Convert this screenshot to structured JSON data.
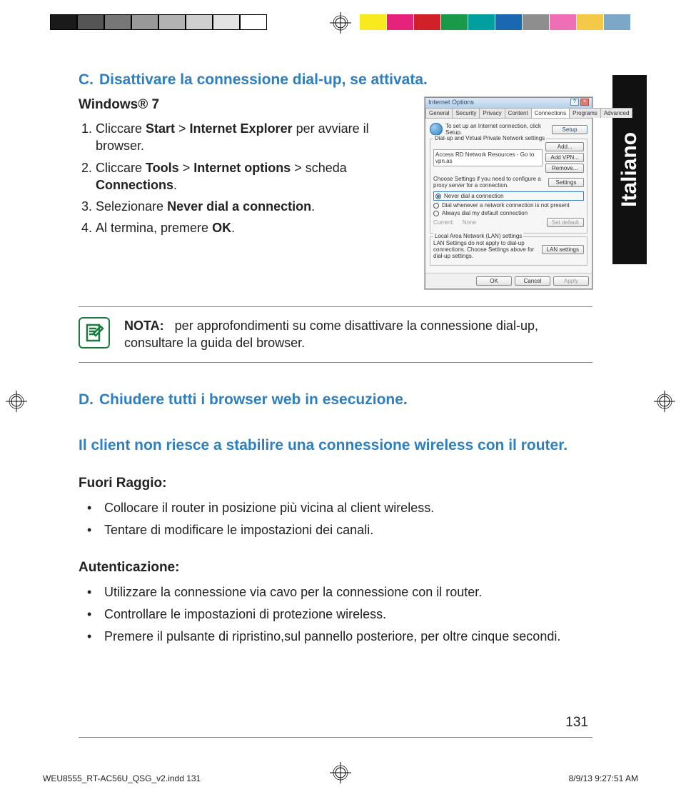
{
  "language_tab": "Italiano",
  "sectionC": {
    "letter": "C.",
    "title": "Disattivare la connessione dial-up, se attivata.",
    "os": "Windows® 7",
    "steps": [
      {
        "pre": "Cliccare ",
        "b1": "Start",
        "mid": " > ",
        "b2": "Internet Explorer",
        "post": " per avviare il browser."
      },
      {
        "pre": "Cliccare ",
        "b1": "Tools",
        "mid": " > ",
        "b2": "Internet options",
        "post2": " > scheda ",
        "b3": "Connections",
        "tail": "."
      },
      {
        "pre": "Selezionare ",
        "b1": "Never dial a connection",
        "tail": "."
      },
      {
        "pre": "Al termina, premere ",
        "b1": "OK",
        "tail": "."
      }
    ]
  },
  "screenshot": {
    "title": "Internet Options",
    "tabs": [
      "General",
      "Security",
      "Privacy",
      "Content",
      "Connections",
      "Programs",
      "Advanced"
    ],
    "active_tab": "Connections",
    "setup_text": "To set up an Internet connection, click Setup.",
    "setup_btn": "Setup",
    "dialup_legend": "Dial-up and Virtual Private Network settings",
    "list_item": "Access RD Network Resources - Go to vpn.as",
    "btns": {
      "add": "Add...",
      "addvpn": "Add VPN...",
      "remove": "Remove..."
    },
    "proxy_text": "Choose Settings if you need to configure a proxy server for a connection.",
    "settings_btn": "Settings",
    "radio1": "Never dial a connection",
    "radio2": "Dial whenever a network connection is not present",
    "radio3": "Always dial my default connection",
    "current": "Current:",
    "none": "None",
    "setdefault": "Set default",
    "lan_legend": "Local Area Network (LAN) settings",
    "lan_text": "LAN Settings do not apply to dial-up connections. Choose Settings above for dial-up settings.",
    "lan_btn": "LAN settings",
    "ok": "OK",
    "cancel": "Cancel",
    "apply": "Apply"
  },
  "note": {
    "label": "NOTA:",
    "text": "per approfondimenti su come disattivare la connessione dial-up, consultare la guida del browser."
  },
  "sectionD": {
    "letter": "D.",
    "title": "Chiudere tutti i browser web in esecuzione."
  },
  "problem_heading": "Il client non riesce a stabilire una connessione wireless con il router.",
  "fuori_raggio": {
    "title": "Fuori Raggio:",
    "items": [
      "Collocare il router in posizione più vicina al client wireless.",
      "Tentare di modificare le impostazioni dei canali."
    ]
  },
  "autenticazione": {
    "title": "Autenticazione:",
    "items": [
      "Utilizzare la connessione via cavo per la connessione con il router.",
      "Controllare le impostazioni di protezione wireless.",
      "Premere il pulsante di ripristino,sul pannello posteriore, per oltre cinque secondi."
    ]
  },
  "page_number": "131",
  "footer_left": "WEU8555_RT-AC56U_QSG_v2.indd   131",
  "footer_right": "8/9/13   9:27:51 AM",
  "colors_left": [
    "#1a1a1a",
    "#555555",
    "#777777",
    "#999999",
    "#b3b3b3",
    "#cfcfcf",
    "#e3e3e3",
    "#ffffff"
  ],
  "colors_right": [
    "#ffffff",
    "#f7ea1e",
    "#e5237b",
    "#d12028",
    "#1a9a49",
    "#00a0a0",
    "#1b67b2",
    "#8e8e8e",
    "#ef6fb6",
    "#f5c948",
    "#7da7c7"
  ]
}
